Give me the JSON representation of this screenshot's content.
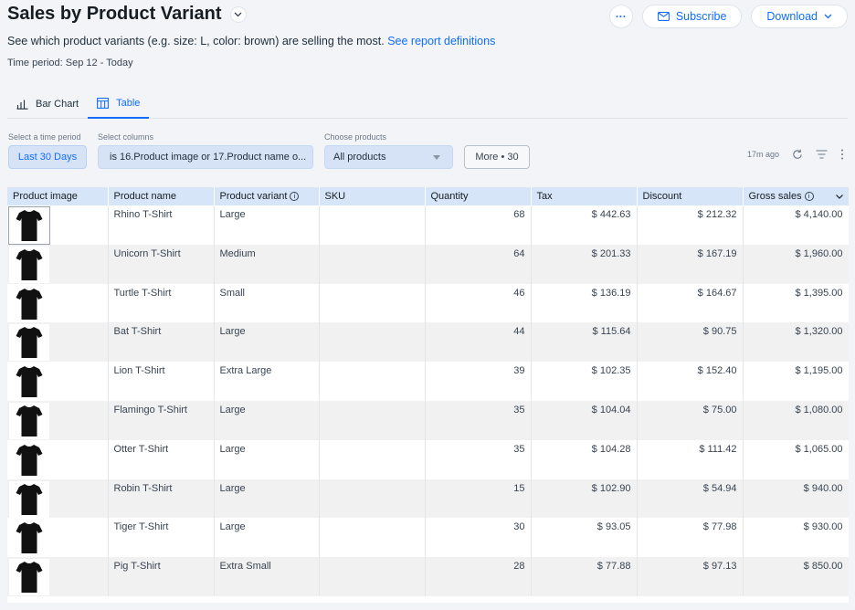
{
  "header": {
    "title": "Sales by Product Variant",
    "subtitle_text": "See which product variants (e.g. size: L, color: brown) are selling the most.",
    "subtitle_link": "See report definitions",
    "time_period": "Time period: Sep 12 - Today",
    "more_label": "···",
    "subscribe_label": "Subscribe",
    "download_label": "Download"
  },
  "tabs": [
    {
      "label": "Bar Chart",
      "active": false
    },
    {
      "label": "Table",
      "active": true
    }
  ],
  "filters": {
    "time_label": "Select a time period",
    "time_value": "Last 30 Days",
    "columns_label": "Select columns",
    "columns_value": "is 16.Product image or 17.Product name o...",
    "products_label": "Choose products",
    "products_value": "All products",
    "more_value": "More • 30",
    "updated": "17m ago"
  },
  "table": {
    "columns": [
      "Product image",
      "Product name",
      "Product variant",
      "SKU",
      "Quantity",
      "Tax",
      "Discount",
      "Gross sales"
    ],
    "rows": [
      {
        "name": "Rhino T-Shirt",
        "variant": "Large",
        "sku": "",
        "quantity": "68",
        "tax": "$ 442.63",
        "discount": "$ 212.32",
        "gross": "$ 4,140.00"
      },
      {
        "name": "Unicorn T-Shirt",
        "variant": "Medium",
        "sku": "",
        "quantity": "64",
        "tax": "$ 201.33",
        "discount": "$ 167.19",
        "gross": "$ 1,960.00"
      },
      {
        "name": "Turtle T-Shirt",
        "variant": "Small",
        "sku": "",
        "quantity": "46",
        "tax": "$ 136.19",
        "discount": "$ 164.67",
        "gross": "$ 1,395.00"
      },
      {
        "name": "Bat T-Shirt",
        "variant": "Large",
        "sku": "",
        "quantity": "44",
        "tax": "$ 115.64",
        "discount": "$ 90.75",
        "gross": "$ 1,320.00"
      },
      {
        "name": "Lion T-Shirt",
        "variant": "Extra Large",
        "sku": "",
        "quantity": "39",
        "tax": "$ 102.35",
        "discount": "$ 152.40",
        "gross": "$ 1,195.00"
      },
      {
        "name": "Flamingo T-Shirt",
        "variant": "Large",
        "sku": "",
        "quantity": "35",
        "tax": "$ 104.04",
        "discount": "$ 75.00",
        "gross": "$ 1,080.00"
      },
      {
        "name": "Otter T-Shirt",
        "variant": "Large",
        "sku": "",
        "quantity": "35",
        "tax": "$ 104.28",
        "discount": "$ 111.42",
        "gross": "$ 1,065.00"
      },
      {
        "name": "Robin T-Shirt",
        "variant": "Large",
        "sku": "",
        "quantity": "15",
        "tax": "$ 102.90",
        "discount": "$ 54.94",
        "gross": "$ 940.00"
      },
      {
        "name": "Tiger T-Shirt",
        "variant": "Large",
        "sku": "",
        "quantity": "30",
        "tax": "$ 93.05",
        "discount": "$ 77.98",
        "gross": "$ 930.00"
      },
      {
        "name": "Pig T-Shirt",
        "variant": "Extra Small",
        "sku": "",
        "quantity": "28",
        "tax": "$ 77.88",
        "discount": "$ 97.13",
        "gross": "$ 850.00"
      }
    ]
  },
  "colors": {
    "accent": "#116dff",
    "header_bg": "#d6e5f7",
    "page_bg": "#f2f4f8"
  }
}
